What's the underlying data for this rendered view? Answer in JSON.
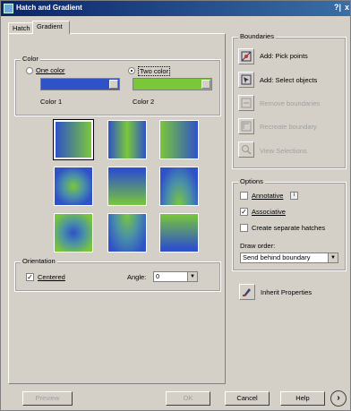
{
  "window": {
    "title": "Hatch and Gradient",
    "help_glyph": "?|",
    "close_glyph": "x"
  },
  "tabs": [
    {
      "label": "Hatch"
    },
    {
      "label": "Gradient"
    }
  ],
  "color": {
    "group_label": "Color",
    "one_color_label": "One color",
    "two_color_label": "Two color",
    "selected": "two",
    "color1_label": "Color 1",
    "color2_label": "Color 2",
    "color1_hex": "#2f52c8",
    "color2_hex": "#7ac83a"
  },
  "orientation": {
    "group_label": "Orientation",
    "centered_label": "Centered",
    "centered_checked": true,
    "angle_label": "Angle:",
    "angle_value": "0"
  },
  "boundaries": {
    "group_label": "Boundaries",
    "add_pick_points": "Add: Pick points",
    "add_select_objects": "Add: Select objects",
    "remove_boundaries": "Remove boundaries",
    "recreate_boundary": "Recreate boundary",
    "view_selections": "View Selections"
  },
  "options": {
    "group_label": "Options",
    "annotative_label": "Annotative",
    "annotative_checked": false,
    "associative_label": "Associative",
    "associative_checked": true,
    "separate_label": "Create separate hatches",
    "separate_checked": false,
    "draw_order_label": "Draw order:",
    "draw_order_value": "Send behind boundary"
  },
  "inherit_properties": "Inherit Properties",
  "footer": {
    "preview": "Preview",
    "ok": "OK",
    "cancel": "Cancel",
    "help": "Help"
  }
}
